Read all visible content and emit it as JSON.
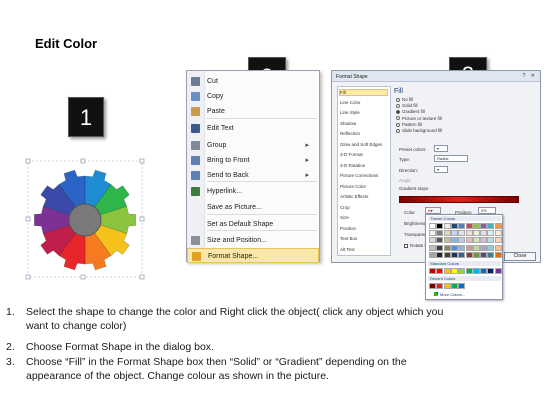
{
  "page": {
    "title": "Edit Color",
    "step_badges": [
      "1",
      "2",
      "3"
    ]
  },
  "context_menu": {
    "items": [
      {
        "label": "Cut",
        "icon": "scissors-icon",
        "submenu": false
      },
      {
        "label": "Copy",
        "icon": "copy-icon",
        "submenu": false
      },
      {
        "label": "Paste",
        "icon": "paste-icon",
        "submenu": false
      },
      {
        "label": "Edit Text",
        "icon": "edit-text-icon",
        "submenu": false
      },
      {
        "label": "Group",
        "icon": "group-icon",
        "submenu": true
      },
      {
        "label": "Bring to Front",
        "icon": "bring-front-icon",
        "submenu": true
      },
      {
        "label": "Send to Back",
        "icon": "send-back-icon",
        "submenu": true
      },
      {
        "label": "Hyperlink...",
        "icon": "hyperlink-icon",
        "submenu": false
      },
      {
        "label": "Save as Picture...",
        "icon": "",
        "submenu": false
      },
      {
        "label": "Set as Default Shape",
        "icon": "",
        "submenu": false
      },
      {
        "label": "Size and Position...",
        "icon": "size-position-icon",
        "submenu": false
      },
      {
        "label": "Format Shape...",
        "icon": "format-shape-icon",
        "submenu": false,
        "highlighted": true
      }
    ]
  },
  "format_dialog": {
    "title": "Format Shape",
    "categories": [
      "Fill",
      "Line Color",
      "Line Style",
      "Shadow",
      "Reflection",
      "Glow and Soft Edges",
      "3-D Format",
      "3-D Rotation",
      "Picture Corrections",
      "Picture Color",
      "Artistic Effects",
      "Crop",
      "Size",
      "Position",
      "Text Box",
      "Alt Text"
    ],
    "selected_category": "Fill",
    "section_title": "Fill",
    "fill_options": [
      "No fill",
      "Solid fill",
      "Gradient fill",
      "Picture or texture fill",
      "Pattern fill",
      "Slide background fill"
    ],
    "selected_fill": "Gradient fill",
    "preset_colors_label": "Preset colors:",
    "type_label": "Type:",
    "type_value": "Radial",
    "direction_label": "Direction:",
    "angle_label": "Angle:",
    "gradient_stops_label": "Gradient stops",
    "color_label": "Color",
    "position_label": "Position:",
    "position_value": "0%",
    "brightness_label": "Brightness:",
    "transparency_label": "Transparency:",
    "rotate_label": "Rotate with shape",
    "close_label": "Close",
    "palette": {
      "theme_label": "Theme Colors",
      "standard_label": "Standard Colors",
      "recent_label": "Recent Colors",
      "more_label": "More Colors...",
      "standard_colors": [
        "#c00000",
        "#ff0000",
        "#ffc000",
        "#ffff00",
        "#92d050",
        "#00b050",
        "#00b0f0",
        "#0070c0",
        "#002060",
        "#7030a0"
      ],
      "recent_colors": [
        "#7a0000",
        "#e21f1f",
        "#ffc000",
        "#00b050",
        "#0070c0"
      ]
    }
  },
  "instructions": [
    {
      "num": "1.",
      "lines": [
        "Select the shape to change the color and Right click the object( click any object which you",
        "want to change color)"
      ]
    },
    {
      "num": "2.",
      "lines": [
        "Choose Format Shape in the dialog box."
      ]
    },
    {
      "num": "3.",
      "lines": [
        "Choose “Fill” in the Format Shape box then “Solid” or “Gradient” depending on the",
        "appearance of the object. Change colour as shown in the picture."
      ]
    }
  ],
  "gear_colors": [
    "#1f8dd6",
    "#2fb64a",
    "#8bc53f",
    "#f5c21b",
    "#f47b20",
    "#e7262b",
    "#c01f4b",
    "#7b3294",
    "#3b4aa8",
    "#2a64c6"
  ]
}
